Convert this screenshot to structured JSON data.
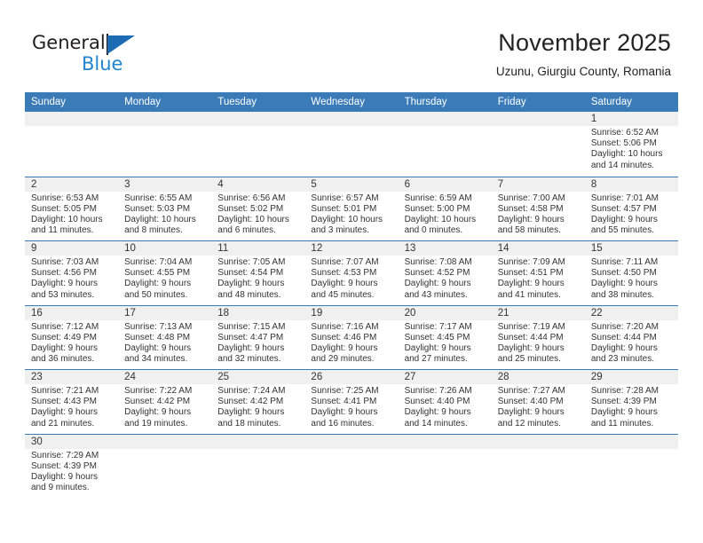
{
  "brand": {
    "word_one": "General",
    "word_two": "Blue",
    "triangle_icon": "brand-triangle-icon",
    "accent_color": "#2185d0",
    "triangle_color": "#1d6cb3"
  },
  "header": {
    "month_title": "November 2025",
    "location": "Uzunu, Giurgiu County, Romania"
  },
  "calendar": {
    "header_background": "#3b7cb8",
    "day_band_background": "#f0f0f0",
    "weekdays": [
      "Sunday",
      "Monday",
      "Tuesday",
      "Wednesday",
      "Thursday",
      "Friday",
      "Saturday"
    ],
    "weeks": [
      [
        {
          "day": "",
          "sunrise": "",
          "sunset": "",
          "daylight_line1": "",
          "daylight_line2": ""
        },
        {
          "day": "",
          "sunrise": "",
          "sunset": "",
          "daylight_line1": "",
          "daylight_line2": ""
        },
        {
          "day": "",
          "sunrise": "",
          "sunset": "",
          "daylight_line1": "",
          "daylight_line2": ""
        },
        {
          "day": "",
          "sunrise": "",
          "sunset": "",
          "daylight_line1": "",
          "daylight_line2": ""
        },
        {
          "day": "",
          "sunrise": "",
          "sunset": "",
          "daylight_line1": "",
          "daylight_line2": ""
        },
        {
          "day": "",
          "sunrise": "",
          "sunset": "",
          "daylight_line1": "",
          "daylight_line2": ""
        },
        {
          "day": "1",
          "sunrise": "Sunrise: 6:52 AM",
          "sunset": "Sunset: 5:06 PM",
          "daylight_line1": "Daylight: 10 hours",
          "daylight_line2": "and 14 minutes."
        }
      ],
      [
        {
          "day": "2",
          "sunrise": "Sunrise: 6:53 AM",
          "sunset": "Sunset: 5:05 PM",
          "daylight_line1": "Daylight: 10 hours",
          "daylight_line2": "and 11 minutes."
        },
        {
          "day": "3",
          "sunrise": "Sunrise: 6:55 AM",
          "sunset": "Sunset: 5:03 PM",
          "daylight_line1": "Daylight: 10 hours",
          "daylight_line2": "and 8 minutes."
        },
        {
          "day": "4",
          "sunrise": "Sunrise: 6:56 AM",
          "sunset": "Sunset: 5:02 PM",
          "daylight_line1": "Daylight: 10 hours",
          "daylight_line2": "and 6 minutes."
        },
        {
          "day": "5",
          "sunrise": "Sunrise: 6:57 AM",
          "sunset": "Sunset: 5:01 PM",
          "daylight_line1": "Daylight: 10 hours",
          "daylight_line2": "and 3 minutes."
        },
        {
          "day": "6",
          "sunrise": "Sunrise: 6:59 AM",
          "sunset": "Sunset: 5:00 PM",
          "daylight_line1": "Daylight: 10 hours",
          "daylight_line2": "and 0 minutes."
        },
        {
          "day": "7",
          "sunrise": "Sunrise: 7:00 AM",
          "sunset": "Sunset: 4:58 PM",
          "daylight_line1": "Daylight: 9 hours",
          "daylight_line2": "and 58 minutes."
        },
        {
          "day": "8",
          "sunrise": "Sunrise: 7:01 AM",
          "sunset": "Sunset: 4:57 PM",
          "daylight_line1": "Daylight: 9 hours",
          "daylight_line2": "and 55 minutes."
        }
      ],
      [
        {
          "day": "9",
          "sunrise": "Sunrise: 7:03 AM",
          "sunset": "Sunset: 4:56 PM",
          "daylight_line1": "Daylight: 9 hours",
          "daylight_line2": "and 53 minutes."
        },
        {
          "day": "10",
          "sunrise": "Sunrise: 7:04 AM",
          "sunset": "Sunset: 4:55 PM",
          "daylight_line1": "Daylight: 9 hours",
          "daylight_line2": "and 50 minutes."
        },
        {
          "day": "11",
          "sunrise": "Sunrise: 7:05 AM",
          "sunset": "Sunset: 4:54 PM",
          "daylight_line1": "Daylight: 9 hours",
          "daylight_line2": "and 48 minutes."
        },
        {
          "day": "12",
          "sunrise": "Sunrise: 7:07 AM",
          "sunset": "Sunset: 4:53 PM",
          "daylight_line1": "Daylight: 9 hours",
          "daylight_line2": "and 45 minutes."
        },
        {
          "day": "13",
          "sunrise": "Sunrise: 7:08 AM",
          "sunset": "Sunset: 4:52 PM",
          "daylight_line1": "Daylight: 9 hours",
          "daylight_line2": "and 43 minutes."
        },
        {
          "day": "14",
          "sunrise": "Sunrise: 7:09 AM",
          "sunset": "Sunset: 4:51 PM",
          "daylight_line1": "Daylight: 9 hours",
          "daylight_line2": "and 41 minutes."
        },
        {
          "day": "15",
          "sunrise": "Sunrise: 7:11 AM",
          "sunset": "Sunset: 4:50 PM",
          "daylight_line1": "Daylight: 9 hours",
          "daylight_line2": "and 38 minutes."
        }
      ],
      [
        {
          "day": "16",
          "sunrise": "Sunrise: 7:12 AM",
          "sunset": "Sunset: 4:49 PM",
          "daylight_line1": "Daylight: 9 hours",
          "daylight_line2": "and 36 minutes."
        },
        {
          "day": "17",
          "sunrise": "Sunrise: 7:13 AM",
          "sunset": "Sunset: 4:48 PM",
          "daylight_line1": "Daylight: 9 hours",
          "daylight_line2": "and 34 minutes."
        },
        {
          "day": "18",
          "sunrise": "Sunrise: 7:15 AM",
          "sunset": "Sunset: 4:47 PM",
          "daylight_line1": "Daylight: 9 hours",
          "daylight_line2": "and 32 minutes."
        },
        {
          "day": "19",
          "sunrise": "Sunrise: 7:16 AM",
          "sunset": "Sunset: 4:46 PM",
          "daylight_line1": "Daylight: 9 hours",
          "daylight_line2": "and 29 minutes."
        },
        {
          "day": "20",
          "sunrise": "Sunrise: 7:17 AM",
          "sunset": "Sunset: 4:45 PM",
          "daylight_line1": "Daylight: 9 hours",
          "daylight_line2": "and 27 minutes."
        },
        {
          "day": "21",
          "sunrise": "Sunrise: 7:19 AM",
          "sunset": "Sunset: 4:44 PM",
          "daylight_line1": "Daylight: 9 hours",
          "daylight_line2": "and 25 minutes."
        },
        {
          "day": "22",
          "sunrise": "Sunrise: 7:20 AM",
          "sunset": "Sunset: 4:44 PM",
          "daylight_line1": "Daylight: 9 hours",
          "daylight_line2": "and 23 minutes."
        }
      ],
      [
        {
          "day": "23",
          "sunrise": "Sunrise: 7:21 AM",
          "sunset": "Sunset: 4:43 PM",
          "daylight_line1": "Daylight: 9 hours",
          "daylight_line2": "and 21 minutes."
        },
        {
          "day": "24",
          "sunrise": "Sunrise: 7:22 AM",
          "sunset": "Sunset: 4:42 PM",
          "daylight_line1": "Daylight: 9 hours",
          "daylight_line2": "and 19 minutes."
        },
        {
          "day": "25",
          "sunrise": "Sunrise: 7:24 AM",
          "sunset": "Sunset: 4:42 PM",
          "daylight_line1": "Daylight: 9 hours",
          "daylight_line2": "and 18 minutes."
        },
        {
          "day": "26",
          "sunrise": "Sunrise: 7:25 AM",
          "sunset": "Sunset: 4:41 PM",
          "daylight_line1": "Daylight: 9 hours",
          "daylight_line2": "and 16 minutes."
        },
        {
          "day": "27",
          "sunrise": "Sunrise: 7:26 AM",
          "sunset": "Sunset: 4:40 PM",
          "daylight_line1": "Daylight: 9 hours",
          "daylight_line2": "and 14 minutes."
        },
        {
          "day": "28",
          "sunrise": "Sunrise: 7:27 AM",
          "sunset": "Sunset: 4:40 PM",
          "daylight_line1": "Daylight: 9 hours",
          "daylight_line2": "and 12 minutes."
        },
        {
          "day": "29",
          "sunrise": "Sunrise: 7:28 AM",
          "sunset": "Sunset: 4:39 PM",
          "daylight_line1": "Daylight: 9 hours",
          "daylight_line2": "and 11 minutes."
        }
      ],
      [
        {
          "day": "30",
          "sunrise": "Sunrise: 7:29 AM",
          "sunset": "Sunset: 4:39 PM",
          "daylight_line1": "Daylight: 9 hours",
          "daylight_line2": "and 9 minutes."
        },
        {
          "day": "",
          "sunrise": "",
          "sunset": "",
          "daylight_line1": "",
          "daylight_line2": ""
        },
        {
          "day": "",
          "sunrise": "",
          "sunset": "",
          "daylight_line1": "",
          "daylight_line2": ""
        },
        {
          "day": "",
          "sunrise": "",
          "sunset": "",
          "daylight_line1": "",
          "daylight_line2": ""
        },
        {
          "day": "",
          "sunrise": "",
          "sunset": "",
          "daylight_line1": "",
          "daylight_line2": ""
        },
        {
          "day": "",
          "sunrise": "",
          "sunset": "",
          "daylight_line1": "",
          "daylight_line2": ""
        },
        {
          "day": "",
          "sunrise": "",
          "sunset": "",
          "daylight_line1": "",
          "daylight_line2": ""
        }
      ]
    ]
  }
}
